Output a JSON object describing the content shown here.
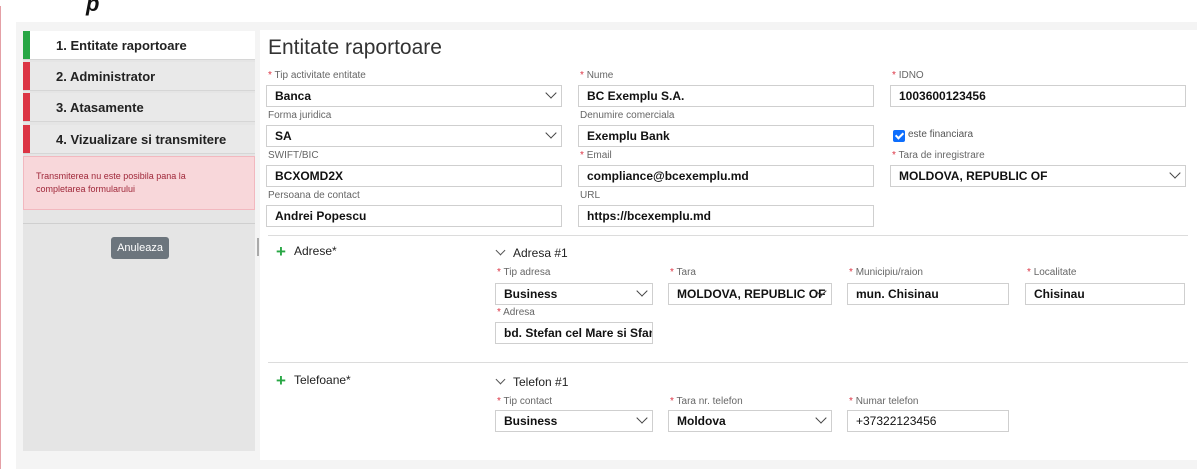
{
  "header": {
    "partial_glyph": "p"
  },
  "sidebar": {
    "steps": [
      {
        "label": "1. Entitate raportoare"
      },
      {
        "label": "2. Administrator"
      },
      {
        "label": "3. Atasamente"
      },
      {
        "label": "4. Vizualizare si transmitere"
      }
    ],
    "alert": "Transmiterea nu este posibila pana la completarea formularului",
    "cancel_label": "Anuleaza"
  },
  "colors": {
    "accent_active": "#28a745",
    "accent_pending": "#dc3545",
    "alert_bg": "#f8d7da",
    "checkbox": "#0d6efd"
  },
  "form": {
    "title": "Entitate raportoare",
    "required_mark": "*",
    "fields": {
      "tip_activitate": {
        "label": "Tip activitate entitate",
        "value": "Banca"
      },
      "nume": {
        "label": "Nume",
        "value": "BC Exemplu S.A."
      },
      "idno": {
        "label": "IDNO",
        "value": "1003600123456"
      },
      "forma_juridica": {
        "label": "Forma juridica",
        "value": "SA"
      },
      "denumire_comerciala": {
        "label": "Denumire comerciala",
        "value": "Exemplu Bank"
      },
      "este_financiara": {
        "label": "este financiara",
        "checked": true
      },
      "swift": {
        "label": "SWIFT/BIC",
        "value": "BCXOMD2X"
      },
      "email": {
        "label": "Email",
        "value": "compliance@bcexemplu.md"
      },
      "tara_inregistrare": {
        "label": "Tara de inregistrare",
        "value": "MOLDOVA, REPUBLIC OF"
      },
      "persoana_contact": {
        "label": "Persoana de contact",
        "value": "Andrei Popescu"
      },
      "url": {
        "label": "URL",
        "value": "https://bcexemplu.md"
      }
    },
    "adrese": {
      "section_label": "Adrese*",
      "item_title": "Adresa #1",
      "tip_adresa": {
        "label": "Tip adresa",
        "value": "Business"
      },
      "tara": {
        "label": "Tara",
        "value": "MOLDOVA, REPUBLIC OF"
      },
      "municipiu": {
        "label": "Municipiu/raion",
        "value": "mun. Chisinau"
      },
      "localitate": {
        "label": "Localitate",
        "value": "Chisinau"
      },
      "adresa": {
        "label": "Adresa",
        "value": "bd. Stefan cel Mare si Sfant"
      }
    },
    "telefoane": {
      "section_label": "Telefoane*",
      "item_title": "Telefon #1",
      "tip_contact": {
        "label": "Tip contact",
        "value": "Business"
      },
      "tara_telefon": {
        "label": "Tara nr. telefon",
        "value": "Moldova"
      },
      "numar_telefon": {
        "label": "Numar telefon",
        "value": "+37322123456"
      }
    }
  },
  "icons": {
    "add": "plus-icon",
    "collapse": "chevron-down-icon",
    "check": "check-icon"
  }
}
